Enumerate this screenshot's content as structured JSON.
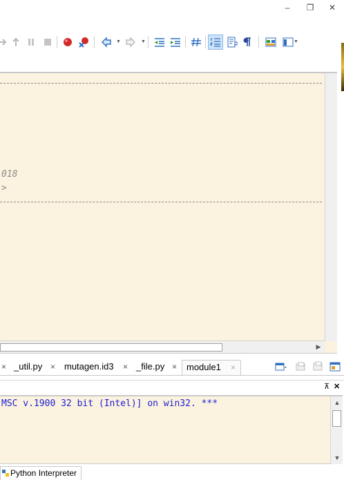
{
  "window": {
    "minimize_glyph": "–",
    "restore_glyph": "❐",
    "close_glyph": "✕"
  },
  "toolbar": {
    "icons": [
      "step-into-icon",
      "step-return-icon",
      "pause-icon",
      "stop-icon",
      "breakpoint-icon",
      "remove-breakpoints-icon",
      "back-icon",
      "forward-icon",
      "outdent-icon",
      "indent-icon",
      "comment-icon",
      "line-numbers-icon",
      "word-wrap-icon",
      "whitespace-icon",
      "layout-icon",
      "view-menu-icon"
    ]
  },
  "editor": {
    "line_1": "018",
    "line_2": ">"
  },
  "tabs": {
    "items": [
      {
        "label": "_util.py",
        "active": false
      },
      {
        "label": "mutagen.id3",
        "active": false
      },
      {
        "label": "_file.py",
        "active": false
      },
      {
        "label": "module1",
        "active": true
      }
    ],
    "close_glyph": "×"
  },
  "console": {
    "pin_glyph": "⊼",
    "close_glyph": "✕",
    "output": "MSC v.1900 32 bit (Intel)] on win32. ***"
  },
  "bottom": {
    "tab_label": "Python Interpreter"
  },
  "colors": {
    "editor_bg": "#fbf3df",
    "console_text": "#1d1dd4",
    "comment_gray": "#8a8a8a",
    "active_tool": "#cde3f7"
  }
}
